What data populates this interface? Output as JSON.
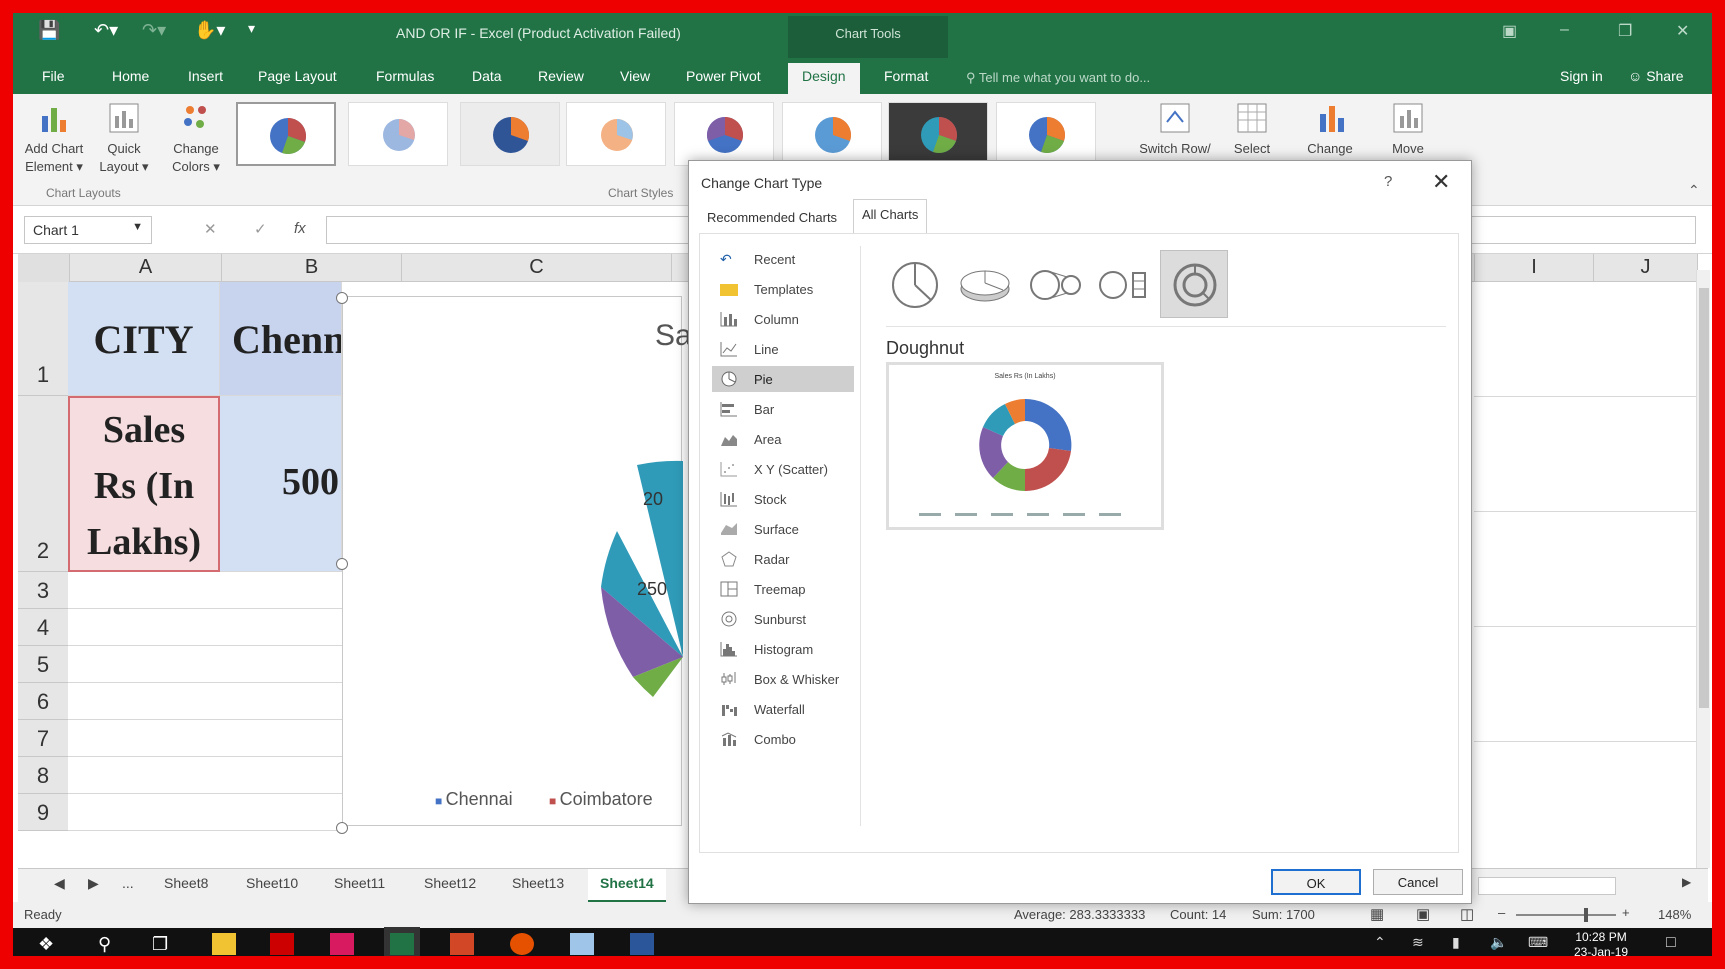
{
  "titlebar": {
    "document_title": "AND OR IF - Excel (Product Activation Failed)",
    "context_tab": "Chart Tools"
  },
  "ribbon_tabs": [
    "File",
    "Home",
    "Insert",
    "Page Layout",
    "Formulas",
    "Data",
    "Review",
    "View",
    "Power Pivot",
    "Design",
    "Format"
  ],
  "active_tab": "Design",
  "tell_me": "Tell me what you want to do...",
  "account": {
    "sign_in": "Sign in",
    "share": "Share"
  },
  "ribbon": {
    "add_chart_element": [
      "Add Chart",
      "Element ▾"
    ],
    "quick_layout": [
      "Quick",
      "Layout ▾"
    ],
    "change_colors": [
      "Change",
      "Colors ▾"
    ],
    "group_chart_layouts": "Chart Layouts",
    "group_chart_styles": "Chart Styles",
    "switch_row": "Switch Row/",
    "select": "Select",
    "change": "Change",
    "move": "Move"
  },
  "formula_bar": {
    "name_box": "Chart 1",
    "fx": "fx"
  },
  "columns": [
    "A",
    "B",
    "C",
    "I",
    "J"
  ],
  "rows": [
    "1",
    "2",
    "3",
    "4",
    "5",
    "6",
    "7",
    "8",
    "9"
  ],
  "cells": {
    "a1": "CITY",
    "b1": "Chenn",
    "a2_lines": [
      "Sales",
      "Rs (In",
      "Lakhs)"
    ],
    "b2": "500"
  },
  "embedded_chart": {
    "title_fragment": "Sa",
    "label_a": "20",
    "label_b": "250",
    "legend": [
      "Chennai",
      "Coimbatore"
    ],
    "colors": {
      "blue": "#4472c4",
      "red": "#c0504d",
      "teal": "#2f9bb8",
      "purple": "#7f5ea8",
      "green": "#70ad47"
    }
  },
  "sheet_tabs": [
    "...",
    "Sheet8",
    "Sheet10",
    "Sheet11",
    "Sheet12",
    "Sheet13",
    "Sheet14"
  ],
  "active_sheet": "Sheet14",
  "status": {
    "ready": "Ready",
    "average": "Average: 283.3333333",
    "count": "Count: 14",
    "sum": "Sum: 1700",
    "zoom": "148%"
  },
  "clock": {
    "time": "10:28 PM",
    "date": "23-Jan-19"
  },
  "dialog": {
    "title": "Change Chart Type",
    "help": "?",
    "tabs": [
      "Recommended Charts",
      "All Charts"
    ],
    "active_tab": "All Charts",
    "types": [
      "Recent",
      "Templates",
      "Column",
      "Line",
      "Pie",
      "Bar",
      "Area",
      "X Y (Scatter)",
      "Stock",
      "Surface",
      "Radar",
      "Treemap",
      "Sunburst",
      "Histogram",
      "Box & Whisker",
      "Waterfall",
      "Combo"
    ],
    "selected_type": "Pie",
    "selected_subtype": "Doughnut",
    "preview_title": "Sales Rs (In Lakhs)",
    "ok": "OK",
    "cancel": "Cancel"
  }
}
